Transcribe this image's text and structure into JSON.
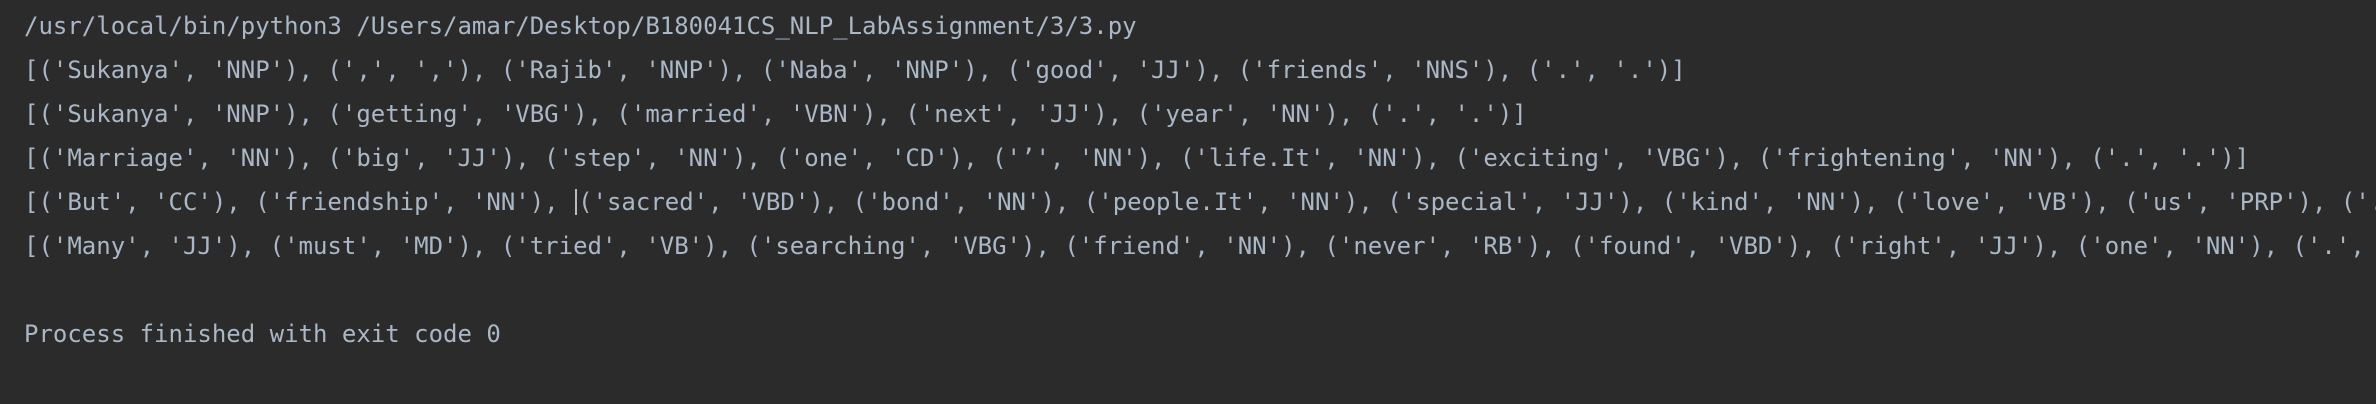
{
  "console": {
    "command": "/usr/local/bin/python3 /Users/amar/Desktop/B180041CS_NLP_LabAssignment/3/3.py",
    "lines": [
      "[('Sukanya', 'NNP'), (',', ','), ('Rajib', 'NNP'), ('Naba', 'NNP'), ('good', 'JJ'), ('friends', 'NNS'), ('.', '.')]",
      "[('Sukanya', 'NNP'), ('getting', 'VBG'), ('married', 'VBN'), ('next', 'JJ'), ('year', 'NN'), ('.', '.')]",
      "[('Marriage', 'NN'), ('big', 'JJ'), ('step', 'NN'), ('one', 'CD'), ('’', 'NN'), ('life.It', 'NN'), ('exciting', 'VBG'), ('frightening', 'NN'), ('.', '.')]"
    ],
    "line4_before_caret": "[('But', 'CC'), ('friendship', 'NN'), ",
    "line4_after_caret": "('sacred', 'VBD'), ('bond', 'NN'), ('people.It', 'NN'), ('special', 'JJ'), ('kind', 'NN'), ('love', 'VB'), ('us', 'PRP'), ('.', '.')]",
    "line5": "[('Many', 'JJ'), ('must', 'MD'), ('tried', 'VB'), ('searching', 'VBG'), ('friend', 'NN'), ('never', 'RB'), ('found', 'VBD'), ('right', 'JJ'), ('one', 'NN'), ('.', '.')]",
    "exit_message": "Process finished with exit code 0"
  },
  "colors": {
    "background": "#2b2b2b",
    "text": "#a9b7c6"
  }
}
